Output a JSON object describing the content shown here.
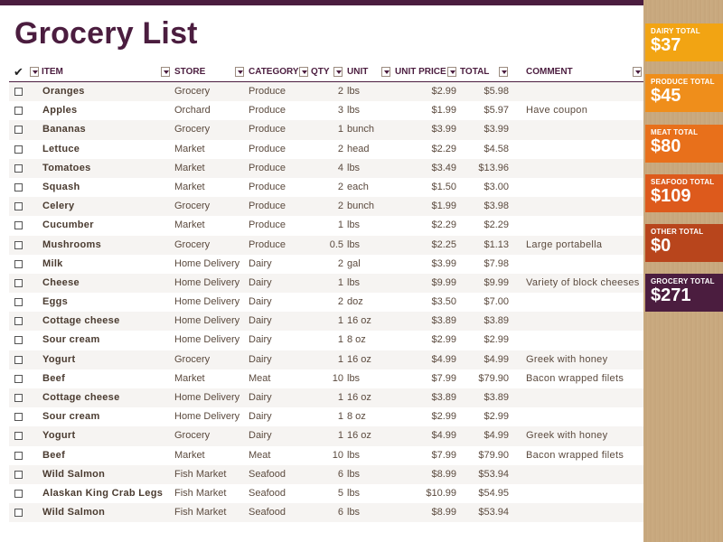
{
  "title": "Grocery List",
  "headers": {
    "check": "✔",
    "item": "ITEM",
    "store": "STORE",
    "category": "CATEGORY",
    "qty": "QTY",
    "unit": "UNIT",
    "unit_price": "UNIT PRICE",
    "total": "TOTAL",
    "comment": "COMMENT"
  },
  "rows": [
    {
      "item": "Oranges",
      "store": "Grocery",
      "category": "Produce",
      "qty": "2",
      "unit": "lbs",
      "price": "$2.99",
      "total": "$5.98",
      "comment": ""
    },
    {
      "item": "Apples",
      "store": "Orchard",
      "category": "Produce",
      "qty": "3",
      "unit": "lbs",
      "price": "$1.99",
      "total": "$5.97",
      "comment": "Have coupon"
    },
    {
      "item": "Bananas",
      "store": "Grocery",
      "category": "Produce",
      "qty": "1",
      "unit": "bunch",
      "price": "$3.99",
      "total": "$3.99",
      "comment": ""
    },
    {
      "item": "Lettuce",
      "store": "Market",
      "category": "Produce",
      "qty": "2",
      "unit": "head",
      "price": "$2.29",
      "total": "$4.58",
      "comment": ""
    },
    {
      "item": "Tomatoes",
      "store": "Market",
      "category": "Produce",
      "qty": "4",
      "unit": "lbs",
      "price": "$3.49",
      "total": "$13.96",
      "comment": ""
    },
    {
      "item": "Squash",
      "store": "Market",
      "category": "Produce",
      "qty": "2",
      "unit": "each",
      "price": "$1.50",
      "total": "$3.00",
      "comment": ""
    },
    {
      "item": "Celery",
      "store": "Grocery",
      "category": "Produce",
      "qty": "2",
      "unit": "bunch",
      "price": "$1.99",
      "total": "$3.98",
      "comment": ""
    },
    {
      "item": "Cucumber",
      "store": "Market",
      "category": "Produce",
      "qty": "1",
      "unit": "lbs",
      "price": "$2.29",
      "total": "$2.29",
      "comment": ""
    },
    {
      "item": "Mushrooms",
      "store": "Grocery",
      "category": "Produce",
      "qty": "0.5",
      "unit": "lbs",
      "price": "$2.25",
      "total": "$1.13",
      "comment": "Large portabella"
    },
    {
      "item": "Milk",
      "store": "Home Delivery",
      "category": "Dairy",
      "qty": "2",
      "unit": "gal",
      "price": "$3.99",
      "total": "$7.98",
      "comment": ""
    },
    {
      "item": "Cheese",
      "store": "Home Delivery",
      "category": "Dairy",
      "qty": "1",
      "unit": "lbs",
      "price": "$9.99",
      "total": "$9.99",
      "comment": "Variety of block cheeses"
    },
    {
      "item": "Eggs",
      "store": "Home Delivery",
      "category": "Dairy",
      "qty": "2",
      "unit": "doz",
      "price": "$3.50",
      "total": "$7.00",
      "comment": ""
    },
    {
      "item": "Cottage cheese",
      "store": "Home Delivery",
      "category": "Dairy",
      "qty": "1",
      "unit": "16 oz",
      "price": "$3.89",
      "total": "$3.89",
      "comment": ""
    },
    {
      "item": "Sour cream",
      "store": "Home Delivery",
      "category": "Dairy",
      "qty": "1",
      "unit": "8 oz",
      "price": "$2.99",
      "total": "$2.99",
      "comment": ""
    },
    {
      "item": "Yogurt",
      "store": "Grocery",
      "category": "Dairy",
      "qty": "1",
      "unit": "16 oz",
      "price": "$4.99",
      "total": "$4.99",
      "comment": "Greek with honey"
    },
    {
      "item": "Beef",
      "store": "Market",
      "category": "Meat",
      "qty": "10",
      "unit": "lbs",
      "price": "$7.99",
      "total": "$79.90",
      "comment": "Bacon wrapped filets"
    },
    {
      "item": "Cottage cheese",
      "store": "Home Delivery",
      "category": "Dairy",
      "qty": "1",
      "unit": "16 oz",
      "price": "$3.89",
      "total": "$3.89",
      "comment": ""
    },
    {
      "item": "Sour cream",
      "store": "Home Delivery",
      "category": "Dairy",
      "qty": "1",
      "unit": "8 oz",
      "price": "$2.99",
      "total": "$2.99",
      "comment": ""
    },
    {
      "item": "Yogurt",
      "store": "Grocery",
      "category": "Dairy",
      "qty": "1",
      "unit": "16 oz",
      "price": "$4.99",
      "total": "$4.99",
      "comment": "Greek with honey"
    },
    {
      "item": "Beef",
      "store": "Market",
      "category": "Meat",
      "qty": "10",
      "unit": "lbs",
      "price": "$7.99",
      "total": "$79.90",
      "comment": "Bacon wrapped filets"
    },
    {
      "item": "Wild Salmon",
      "store": "Fish Market",
      "category": "Seafood",
      "qty": "6",
      "unit": "lbs",
      "price": "$8.99",
      "total": "$53.94",
      "comment": ""
    },
    {
      "item": "Alaskan King Crab Legs",
      "store": "Fish Market",
      "category": "Seafood",
      "qty": "5",
      "unit": "lbs",
      "price": "$10.99",
      "total": "$54.95",
      "comment": ""
    },
    {
      "item": "Wild Salmon",
      "store": "Fish Market",
      "category": "Seafood",
      "qty": "6",
      "unit": "lbs",
      "price": "$8.99",
      "total": "$53.94",
      "comment": ""
    }
  ],
  "summary": [
    {
      "label": "DAIRY TOTAL",
      "value": "$37",
      "color": "#f2a413"
    },
    {
      "label": "PRODUCE TOTAL",
      "value": "$45",
      "color": "#ef8e1b"
    },
    {
      "label": "MEAT TOTAL",
      "value": "$80",
      "color": "#e8701b"
    },
    {
      "label": "SEAFOOD TOTAL",
      "value": "$109",
      "color": "#dd5a1c"
    },
    {
      "label": "OTHER TOTAL",
      "value": "$0",
      "color": "#b8451c"
    },
    {
      "label": "GROCERY TOTAL",
      "value": "$271",
      "color": "#4b1d3f"
    }
  ],
  "colors": {
    "accent": "#4b1d3f",
    "row_alt": "#f6f4f2"
  }
}
